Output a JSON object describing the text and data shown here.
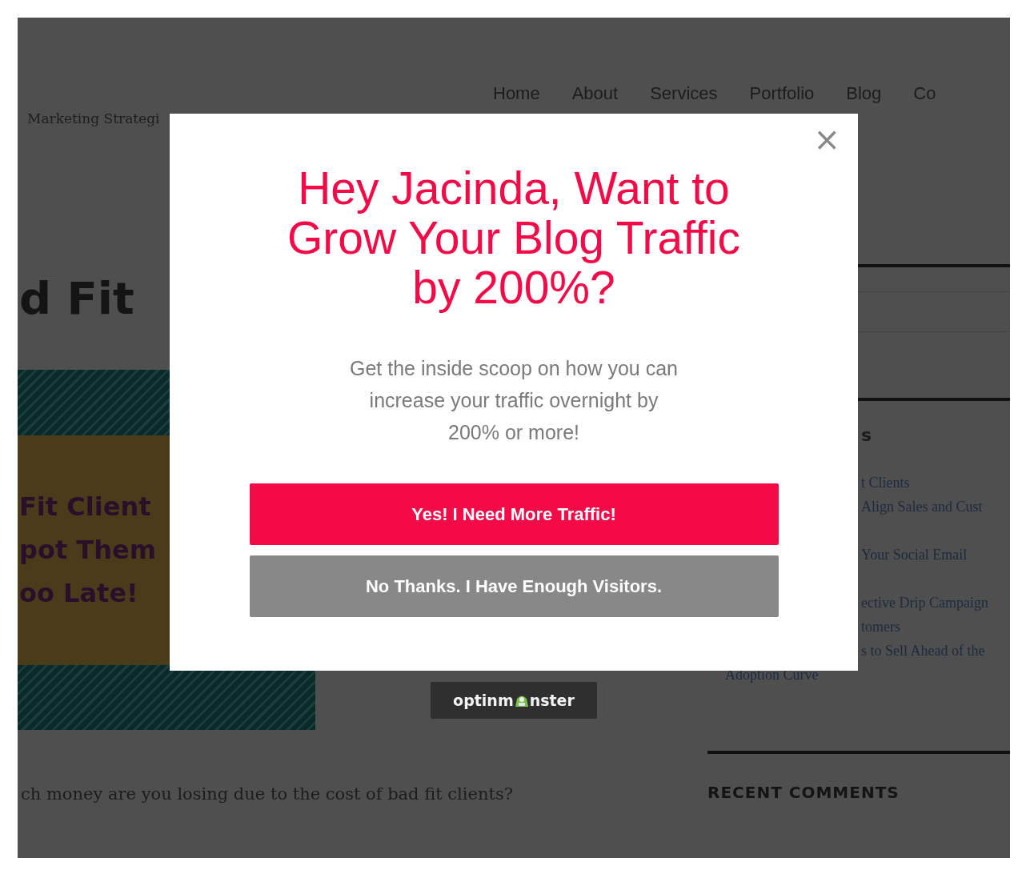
{
  "page": {
    "tagline": "Marketing Strategi",
    "nav": [
      {
        "label": "Home"
      },
      {
        "label": "About"
      },
      {
        "label": "Services"
      },
      {
        "label": "Portfolio"
      },
      {
        "label": "Blog"
      },
      {
        "label": "Co"
      }
    ],
    "post_title": "d Fit",
    "featured_image_lines": [
      "Fit Client",
      "pot Them",
      "oo Late!"
    ],
    "body_text": "ch money are you losing due to the cost of bad fit clients?",
    "sidebar": {
      "heading_fragment": "s",
      "link_fragments": [
        "t Clients",
        "Align Sales and Cust",
        "Your Social Email",
        "ective Drip Campaign",
        "tomers",
        "s to Sell Ahead of the"
      ],
      "last_link": "Adoption Curve",
      "recent_comments_heading": "RECENT COMMENTS"
    }
  },
  "popup": {
    "headline": [
      "Hey Jacinda, Want to",
      "Grow Your Blog Traffic",
      "by 200%?"
    ],
    "subtext": [
      "Get the inside scoop on how you can",
      "increase your traffic overnight by",
      "200% or more!"
    ],
    "buttons": [
      {
        "label": "Yes! I Need More Traffic!",
        "kind": "accept"
      },
      {
        "label": "No Thanks. I Have Enough Visitors.",
        "kind": "decline"
      }
    ],
    "close": "×",
    "badge": {
      "before": "optinm",
      "after": "nster"
    }
  }
}
